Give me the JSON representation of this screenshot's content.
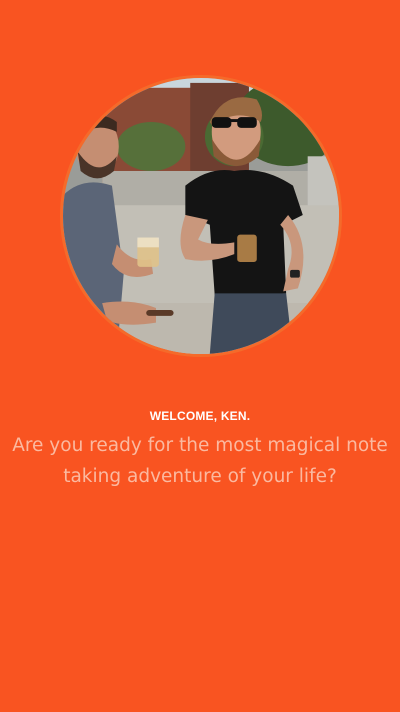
{
  "welcome": {
    "greeting": "WELCOME, KEN.",
    "message": "Are you ready for the most magical note taking adventure of your life?"
  },
  "profile_photo": {
    "description_icon": "user-photo-icon"
  },
  "colors": {
    "background": "#f95421",
    "greeting_text": "#ffffff",
    "message_text": "#fbb9a0",
    "avatar_border": "#f56a2a"
  }
}
